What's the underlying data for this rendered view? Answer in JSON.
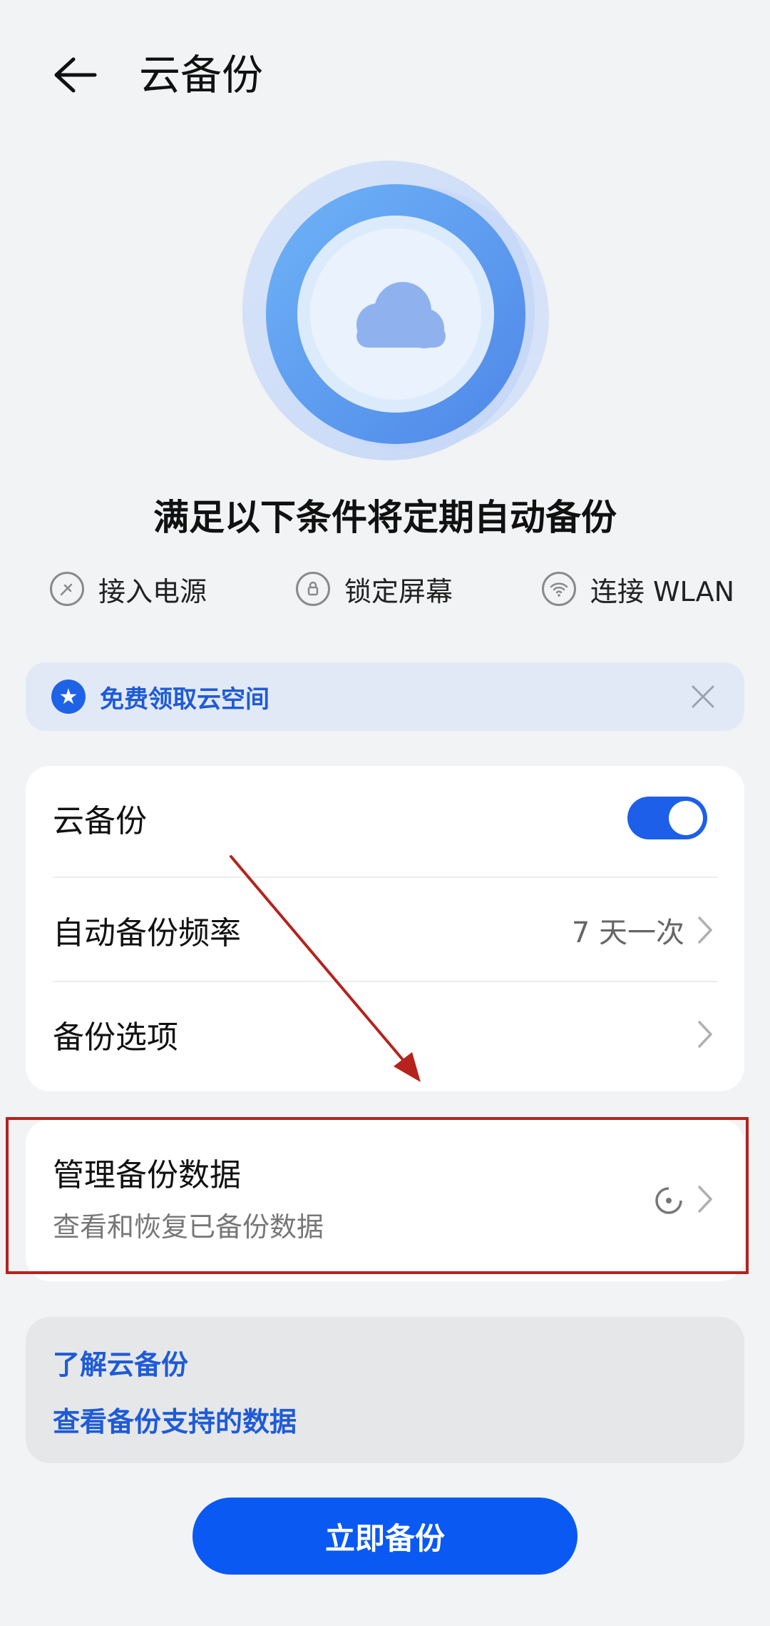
{
  "header": {
    "title": "云备份"
  },
  "conditions": {
    "title": "满足以下条件将定期自动备份",
    "items": [
      {
        "icon": "power-plug-icon",
        "label": "接入电源"
      },
      {
        "icon": "lock-icon",
        "label": "锁定屏幕"
      },
      {
        "icon": "wifi-icon",
        "label": "连接 WLAN"
      }
    ]
  },
  "promo": {
    "label": "免费领取云空间"
  },
  "settings": {
    "cloud_backup_label": "云备份",
    "cloud_backup_enabled": true,
    "frequency_label": "自动备份频率",
    "frequency_value": "7 天一次",
    "options_label": "备份选项"
  },
  "manage": {
    "title": "管理备份数据",
    "subtitle": "查看和恢复已备份数据"
  },
  "links": {
    "learn": "了解云备份",
    "supported": "查看备份支持的数据"
  },
  "action": {
    "backup_now": "立即备份"
  },
  "colors": {
    "accent": "#0a59f2",
    "link": "#1e5bd6",
    "annotation": "#b5231d"
  }
}
